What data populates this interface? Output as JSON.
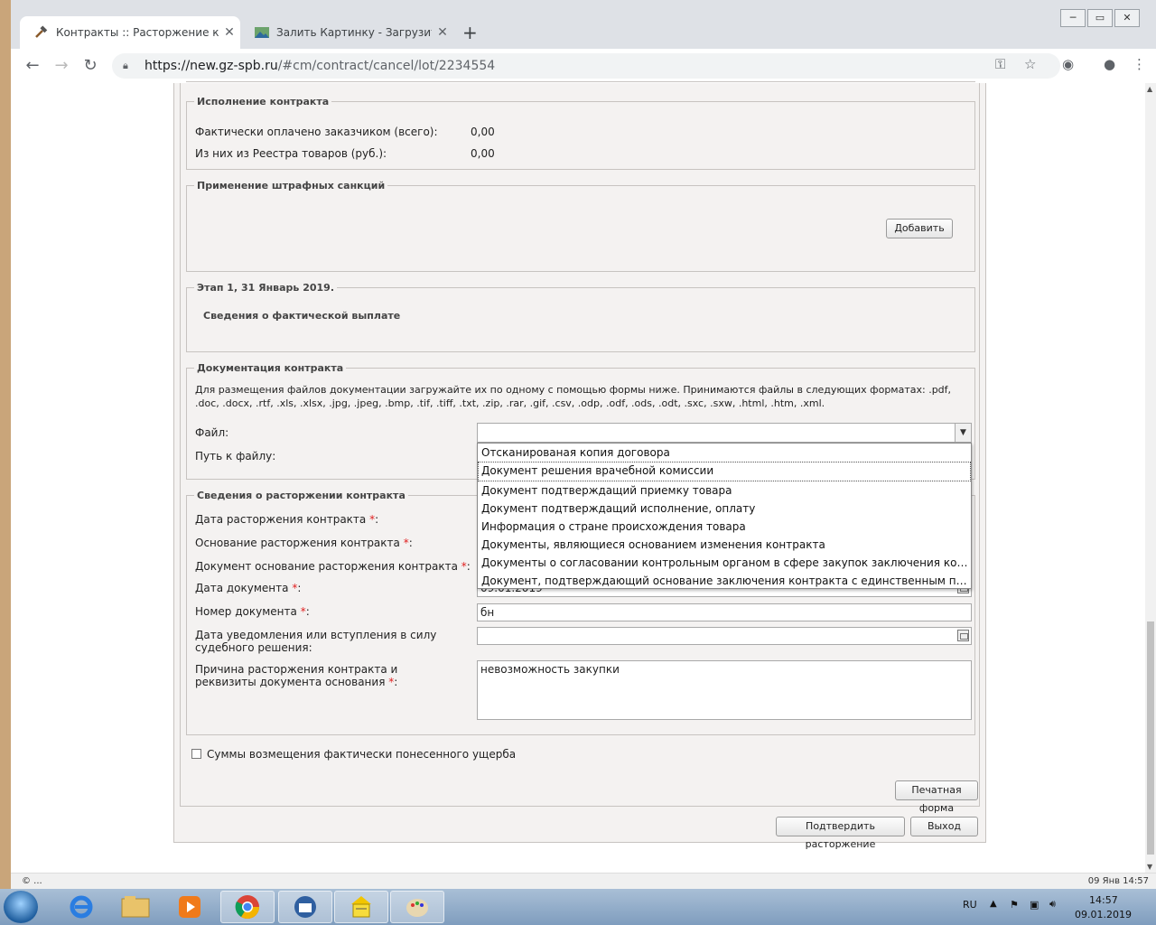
{
  "browser": {
    "tabs": [
      {
        "title": "Контракты :: Расторжение контр",
        "active": true
      },
      {
        "title": "Залить Картинку - Загрузить фо",
        "active": false
      }
    ],
    "new_tab": "+",
    "window_buttons": [
      "─",
      "▭",
      "✕"
    ],
    "url_host": "https://new.gz-spb.ru",
    "url_path": "/#cm/contract/cancel/lot/2234554"
  },
  "sections": {
    "execution": {
      "legend": "Исполнение контракта",
      "paid_label": "Фактически оплачено заказчиком (всего):",
      "paid_value": "0,00",
      "registry_label": "Из них из Реестра товаров (руб.):",
      "registry_value": "0,00"
    },
    "penalties": {
      "legend": "Применение штрафных санкций",
      "add_button": "Добавить"
    },
    "stage": {
      "legend": "Этап 1, 31 Январь 2019.",
      "subtitle": "Сведения о фактической выплате"
    },
    "documentation": {
      "legend": "Документация контракта",
      "hint": "Для размещения файлов документации загружайте их по одному с помощью формы ниже. Принимаются файлы в следующих форматах: .pdf, .doc, .docx, .rtf, .xls, .xlsx, .jpg, .jpeg, .bmp, .tif, .tiff, .txt, .zip, .rar, .gif, .csv, .odp, .odf, .ods, .odt, .sxc, .sxw, .html, .htm, .xml.",
      "file_label": "Файл:",
      "path_label": "Путь к файлу:",
      "file_select_value": "",
      "options": [
        "Отсканированая копия договора",
        "Документ решения врачебной комиссии",
        "Документ подтверждащий приемку товара",
        "Документ подтверждащий исполнение, оплату",
        "Информация о стране происхождения товара",
        "Документы, являющиеся основанием изменения контракта",
        "Документы о согласовании контрольным органом в сфере закупок заключения контракта с единственным поставщиком",
        "Документ, подтверждающий основание заключения контракта с единственным поставщиком"
      ],
      "hovered_option": 1
    },
    "termination": {
      "legend": "Сведения о расторжении контракта",
      "date_label": "Дата расторжения контракта",
      "basis_label": "Основание расторжения контракта",
      "basis_doc_label": "Документ основание расторжения контракта",
      "doc_date_label": "Дата документа",
      "doc_date_value": "09.01.2019",
      "doc_number_label": "Номер документа",
      "doc_number_value": "бн",
      "notify_label": "Дата уведомления или вступления в силу судебного решения:",
      "notify_value": "",
      "reason_label": "Причина расторжения контракта и реквизиты документа основания",
      "reason_value": "невозможность закупки",
      "required_mark": "*",
      "colon": ":"
    },
    "damages_checkbox": "Суммы возмещения фактически понесенного ущерба"
  },
  "buttons": {
    "print": "Печатная форма",
    "confirm": "Подтвердить расторжение",
    "exit": "Выход"
  },
  "statusbar": {
    "left": "© ...",
    "right": "09 Янв 14:57"
  },
  "taskbar": {
    "lang": "RU",
    "time": "14:57",
    "date": "09.01.2019"
  }
}
